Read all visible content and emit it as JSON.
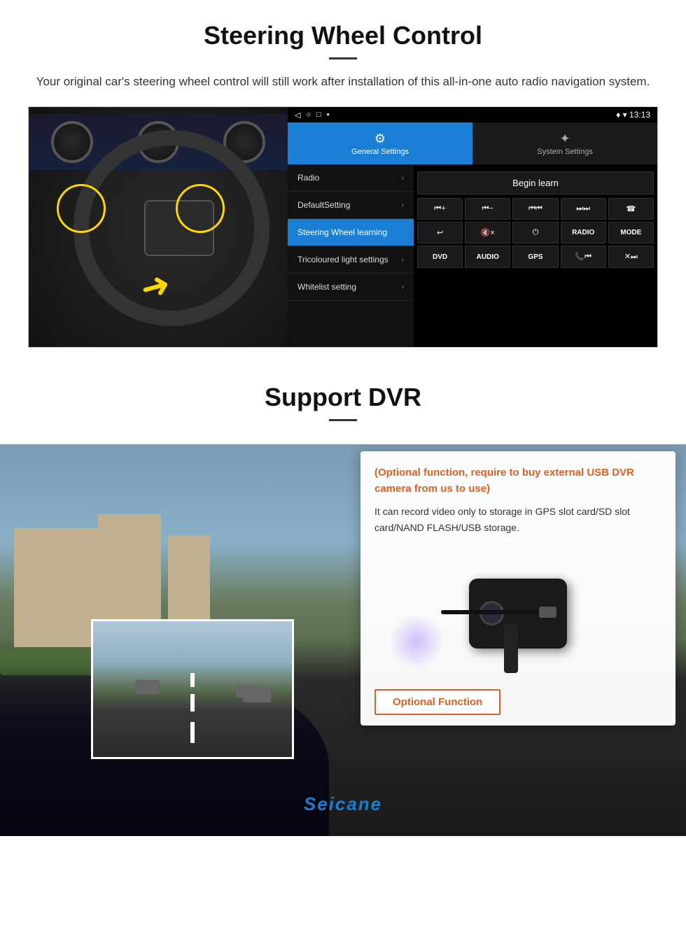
{
  "page": {
    "title": "Steering Wheel Control",
    "title_divider": true,
    "subtitle": "Your original car's steering wheel control will still work after installation of this all-in-one auto radio navigation system.",
    "section2_title": "Support DVR"
  },
  "android_ui": {
    "status_bar": {
      "time": "13:13",
      "signal_icon": "▼",
      "wifi_icon": "▾"
    },
    "tabs": [
      {
        "label": "General Settings",
        "icon": "⚙",
        "active": true
      },
      {
        "label": "System Settings",
        "icon": "✦",
        "active": false
      }
    ],
    "menu_items": [
      {
        "label": "Radio",
        "active": false
      },
      {
        "label": "DefaultSetting",
        "active": false
      },
      {
        "label": "Steering Wheel learning",
        "active": true
      },
      {
        "label": "Tricoloured light settings",
        "active": false
      },
      {
        "label": "Whitelist setting",
        "active": false
      }
    ],
    "begin_learn_label": "Begin learn",
    "control_buttons": [
      "⏮+",
      "⏮-",
      "⏮⏮",
      "⏭⏭",
      "☎",
      "↩",
      "🔇×",
      "⏻",
      "RADIO",
      "MODE",
      "DVD",
      "AUDIO",
      "GPS",
      "📞⏮",
      "✕⏭"
    ]
  },
  "dvr_section": {
    "optional_text": "(Optional function, require to buy external USB DVR camera from us to use)",
    "description": "It can record video only to storage in GPS slot card/SD slot card/NAND FLASH/USB storage.",
    "optional_function_label": "Optional Function",
    "seicane_logo": "Seicane"
  }
}
